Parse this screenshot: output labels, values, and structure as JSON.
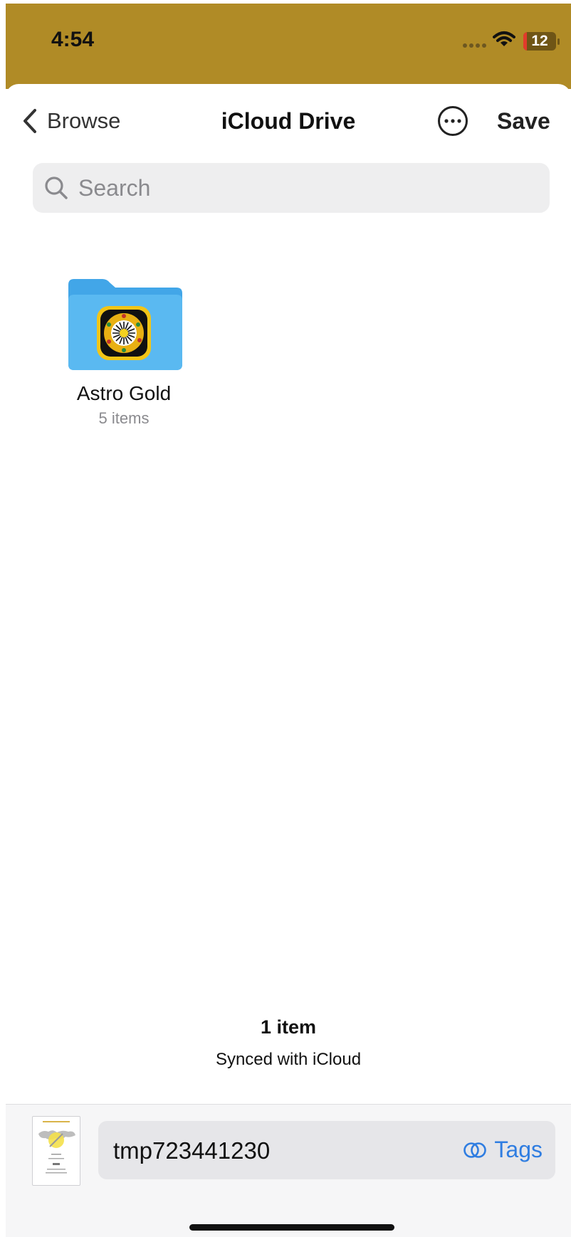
{
  "status": {
    "time": "4:54",
    "battery": "12"
  },
  "nav": {
    "back_label": "Browse",
    "title": "iCloud Drive",
    "save_label": "Save",
    "more_icon": "ellipsis-circle-icon"
  },
  "search": {
    "placeholder": "Search",
    "icon": "search-icon"
  },
  "folders": [
    {
      "name": "Astro Gold",
      "count": "5 items"
    }
  ],
  "footer": {
    "item_count": "1 item",
    "sync_status": "Synced with iCloud"
  },
  "save_bar": {
    "filename": "tmp723441230",
    "tags_label": "Tags"
  },
  "colors": {
    "status_bar": "#b08b26",
    "folder_blue": "#5ab9f1",
    "accent": "#2f7de1"
  }
}
